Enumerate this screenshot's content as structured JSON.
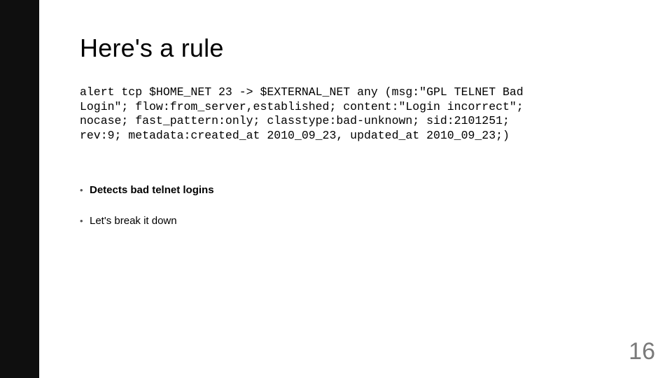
{
  "slide": {
    "title": "Here's a rule",
    "code": "alert tcp $HOME_NET 23 -> $EXTERNAL_NET any (msg:\"GPL TELNET Bad Login\"; flow:from_server,established; content:\"Login incorrect\"; nocase; fast_pattern:only; classtype:bad-unknown; sid:2101251; rev:9; metadata:created_at 2010_09_23, updated_at 2010_09_23;)",
    "bullets": [
      {
        "text": "Detects bad telnet logins",
        "bold": true
      },
      {
        "text": "Let's break it down",
        "bold": false
      }
    ],
    "page_number": "16"
  }
}
